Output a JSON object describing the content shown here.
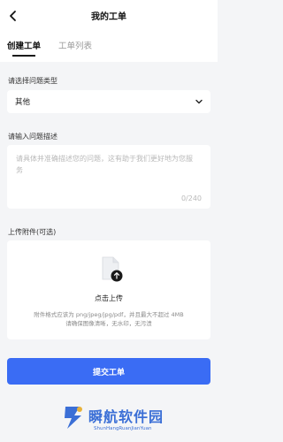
{
  "header": {
    "title": "我的工单",
    "back_icon": "back-chevron-icon"
  },
  "tabs": [
    {
      "label": "创建工单",
      "active": true
    },
    {
      "label": "工单列表",
      "active": false
    }
  ],
  "form": {
    "type_label": "请选择问题类型",
    "type_value": "其他",
    "desc_label": "请输入问题描述",
    "desc_placeholder": "请具体并准确描述您的问题，这有助于我们更好地为您服务",
    "desc_counter": "0/240",
    "attach_label": "上传附件(可选)",
    "upload_label": "点击上传",
    "hint_line1": "附件格式应该为 png/jpeg/jpg/pdf，并且最大不超过 4MB",
    "hint_line2": "请确保图像清晰，无水印，无污渍"
  },
  "submit": {
    "label": "提交工单"
  },
  "watermark": {
    "text": "瞬航软件园",
    "subtext": "ShunHangRuanJianYuan"
  },
  "colors": {
    "accent": "#3a6cf4",
    "background": "#f4f5f7",
    "watermark": "#3b6fd6"
  }
}
